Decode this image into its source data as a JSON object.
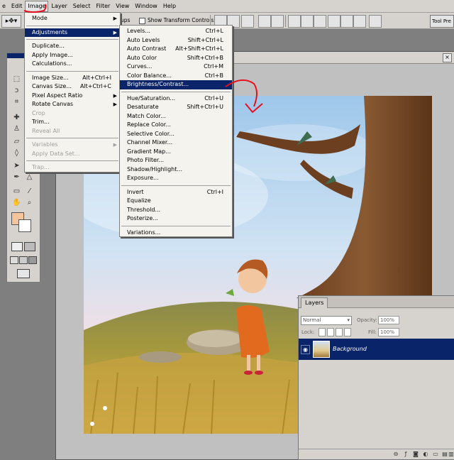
{
  "menubar": {
    "items": [
      "File",
      "Edit",
      "Image",
      "Layer",
      "Select",
      "Filter",
      "View",
      "Window",
      "Help"
    ],
    "partial_file": "e"
  },
  "options": {
    "groups_label": "ups",
    "show_transform": "Show Transform Controls",
    "tool_presets": "Tool Pre"
  },
  "image_menu": {
    "mode": "Mode",
    "adjustments": "Adjustments",
    "duplicate": "Duplicate...",
    "apply_image": "Apply Image...",
    "calculations": "Calculations...",
    "image_size": "Image Size...",
    "image_size_sc": "Alt+Ctrl+I",
    "canvas_size": "Canvas Size...",
    "canvas_size_sc": "Alt+Ctrl+C",
    "pixel_aspect": "Pixel Aspect Ratio",
    "rotate_canvas": "Rotate Canvas",
    "crop": "Crop",
    "trim": "Trim...",
    "reveal_all": "Reveal All",
    "variables": "Variables",
    "apply_data_set": "Apply Data Set...",
    "trap": "Trap..."
  },
  "adjust_menu": {
    "levels": "Levels...",
    "levels_sc": "Ctrl+L",
    "auto_levels": "Auto Levels",
    "auto_levels_sc": "Shift+Ctrl+L",
    "auto_contrast": "Auto Contrast",
    "auto_contrast_sc": "Alt+Shift+Ctrl+L",
    "auto_color": "Auto Color",
    "auto_color_sc": "Shift+Ctrl+B",
    "curves": "Curves...",
    "curves_sc": "Ctrl+M",
    "color_balance": "Color Balance...",
    "color_balance_sc": "Ctrl+B",
    "brightness": "Brightness/Contrast...",
    "hue_sat": "Hue/Saturation...",
    "hue_sat_sc": "Ctrl+U",
    "desaturate": "Desaturate",
    "desaturate_sc": "Shift+Ctrl+U",
    "match_color": "Match Color...",
    "replace_color": "Replace Color...",
    "selective_color": "Selective Color...",
    "channel_mixer": "Channel Mixer...",
    "gradient_map": "Gradient Map...",
    "photo_filter": "Photo Filter...",
    "shadow_highlight": "Shadow/Highlight...",
    "exposure": "Exposure...",
    "invert": "Invert",
    "invert_sc": "Ctrl+I",
    "equalize": "Equalize",
    "threshold": "Threshold...",
    "posterize": "Posterize...",
    "variations": "Variations..."
  },
  "layers": {
    "tab": "Layers",
    "blend_mode": "Normal",
    "opacity_label": "Opacity:",
    "opacity": "100%",
    "lock_label": "Lock:",
    "fill_label": "Fill:",
    "fill": "100%",
    "layer_name": "Background"
  },
  "colors": {
    "selection": "#0a246a",
    "menu_bg": "#f4f3ee",
    "chrome": "#d6d3ce",
    "annotation": "#e8101e"
  }
}
